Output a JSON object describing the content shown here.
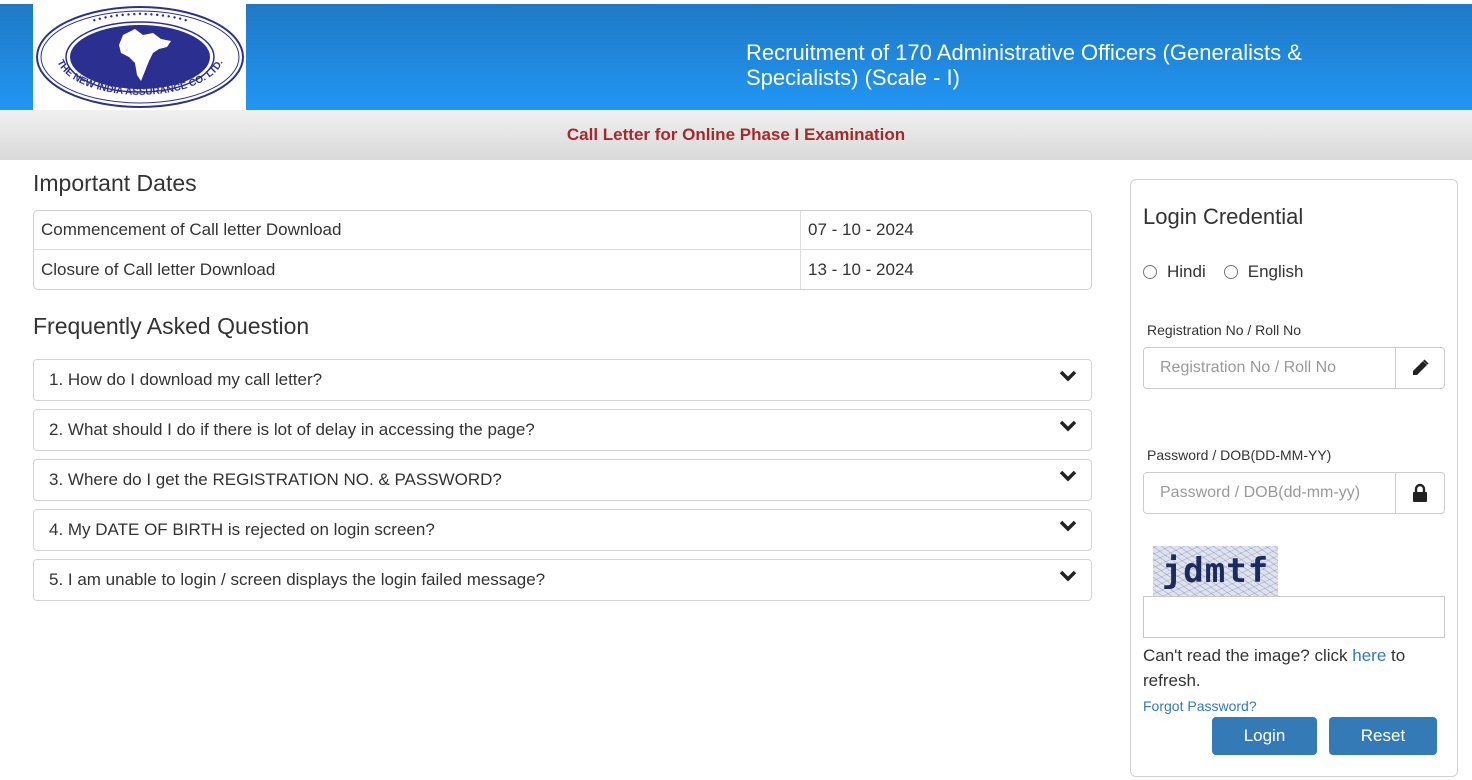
{
  "header": {
    "logo_alt": "The New India Assurance Co. Ltd. logo",
    "logo_text_en": "THE NEW INDIA ASSURANCE CO. LTD.",
    "title": "Recruitment of 170 Administrative Officers (Generalists & Specialists) (Scale - I)"
  },
  "subheader": {
    "title": "Call Letter for Online Phase I Examination"
  },
  "important_dates": {
    "heading": "Important Dates",
    "rows": [
      {
        "label": "Commencement of Call letter Download",
        "date": "07 - 10 - 2024"
      },
      {
        "label": "Closure of Call letter Download",
        "date": "13 - 10 - 2024"
      }
    ]
  },
  "faq": {
    "heading": "Frequently Asked Question",
    "items": [
      {
        "question": "1. How do I download my call letter?",
        "icon": "chevron-down-icon"
      },
      {
        "question": "2. What should I do if there is lot of delay in accessing the page?",
        "icon": "chevron-down-icon"
      },
      {
        "question": "3. Where do I get the REGISTRATION NO. & PASSWORD?",
        "icon": "chevron-down-icon"
      },
      {
        "question": "4. My DATE OF BIRTH is rejected on login screen?",
        "icon": "chevron-down-icon"
      },
      {
        "question": "5. I am unable to login / screen displays the login failed message?",
        "icon": "chevron-down-icon"
      }
    ]
  },
  "login": {
    "title": "Login Credential",
    "languages": [
      {
        "label": "Hindi",
        "selected": false
      },
      {
        "label": "English",
        "selected": false
      }
    ],
    "registration": {
      "label": "Registration No / Roll No",
      "placeholder": "Registration No / Roll No",
      "value": "",
      "icon": "pencil-icon"
    },
    "password": {
      "label": "Password / DOB(DD-MM-YY)",
      "placeholder": "Password / DOB(dd-mm-yy)",
      "value": "",
      "icon": "lock-icon"
    },
    "captcha": {
      "text": "jdmtf",
      "input_value": ""
    },
    "refresh": {
      "prefix": "Can't read the image? click ",
      "link": "here",
      "suffix": " to refresh."
    },
    "forgot_password": "Forgot Password?",
    "login_button": "Login",
    "reset_button": "Reset"
  },
  "colors": {
    "header_gradient_top": "#1f79c5",
    "header_gradient_bottom": "#2196f3",
    "subheader_text": "#a52a2a",
    "button": "#337ab7",
    "link": "#337ab7"
  }
}
